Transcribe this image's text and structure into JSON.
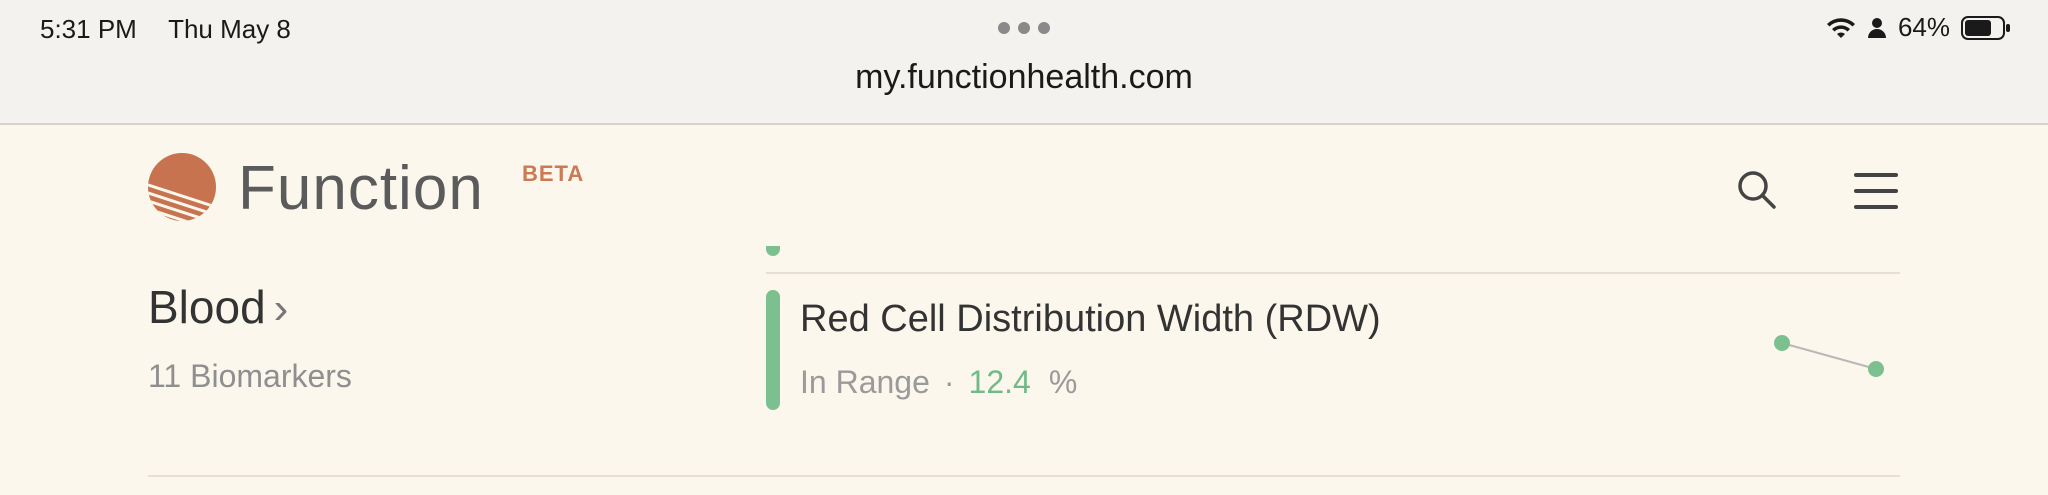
{
  "status_bar": {
    "time": "5:31 PM",
    "date": "Thu May 8",
    "battery_percent": "64%",
    "icons": [
      "wifi-icon",
      "person-icon",
      "battery-icon"
    ]
  },
  "browser": {
    "url": "my.functionhealth.com"
  },
  "header": {
    "brand": "Function",
    "badge": "BETA",
    "icons": [
      "search-icon",
      "menu-icon"
    ]
  },
  "category": {
    "title": "Blood",
    "count_label": "11 Biomarkers"
  },
  "biomarker": {
    "name": "Red Cell Distribution Width (RDW)",
    "status": "In Range",
    "separator": "·",
    "value": "12.4",
    "unit": "%",
    "status_color": "#7dc08f"
  },
  "colors": {
    "accent": "#cb7a55",
    "in_range": "#7dc08f",
    "background": "#fcf7ec"
  }
}
